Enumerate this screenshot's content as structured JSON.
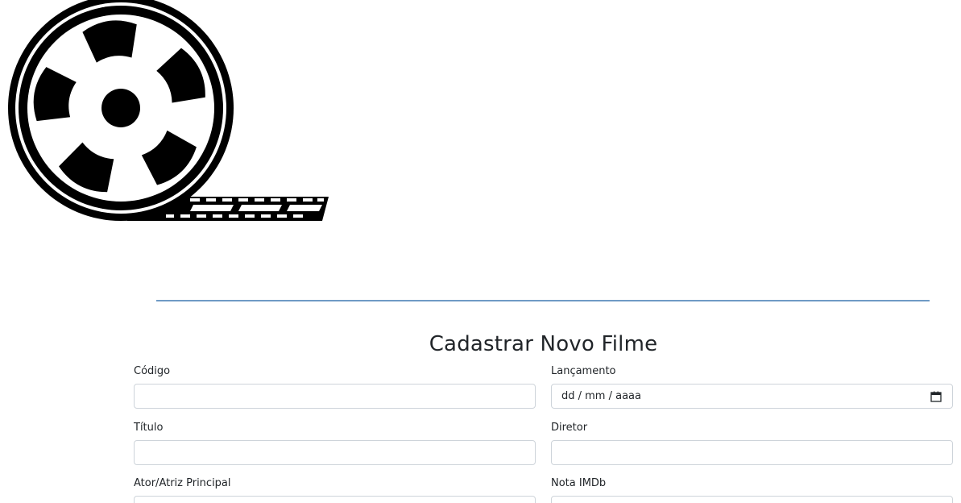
{
  "header": {
    "logo_icon": "film-reel-icon"
  },
  "form": {
    "title": "Cadastrar Novo Filme",
    "fields": {
      "codigo": {
        "label": "Código",
        "value": "",
        "placeholder": ""
      },
      "lancamento": {
        "label": "Lançamento",
        "value": "dd / mm / aaaa",
        "icon": "calendar-icon"
      },
      "titulo": {
        "label": "Título",
        "value": "",
        "placeholder": ""
      },
      "diretor": {
        "label": "Diretor",
        "value": "",
        "placeholder": ""
      },
      "ator": {
        "label": "Ator/Atriz Principal",
        "value": "",
        "placeholder": ""
      },
      "nota": {
        "label": "Nota IMDb",
        "value": "",
        "placeholder": ""
      }
    }
  },
  "colors": {
    "divider": "#6f9ac5",
    "input_border": "#ced4da",
    "text": "#212529"
  }
}
